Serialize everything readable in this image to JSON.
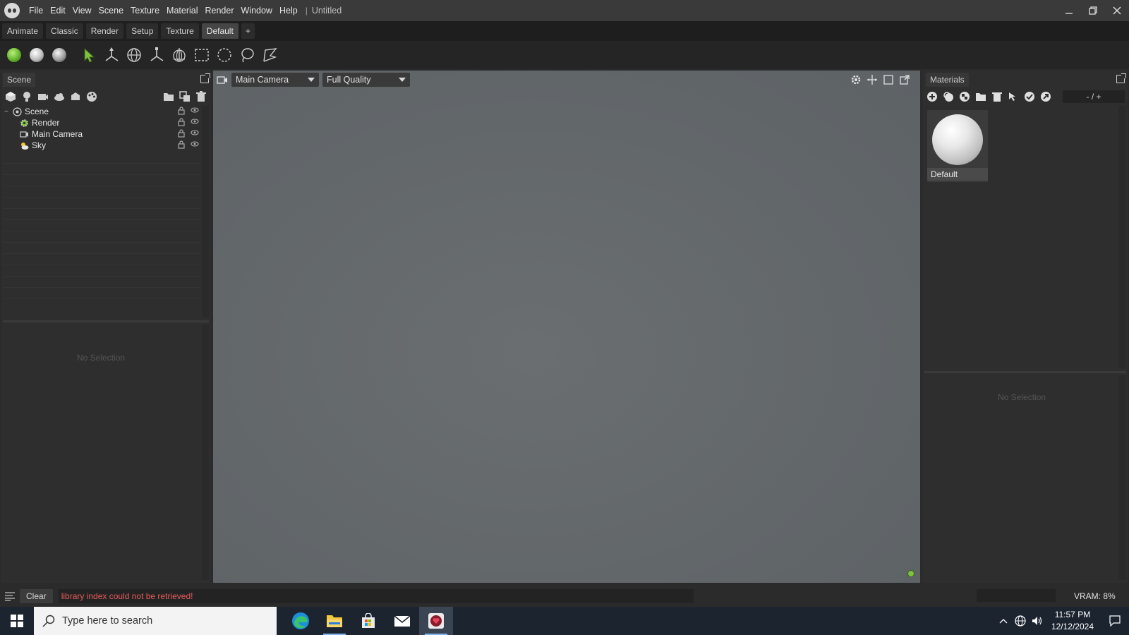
{
  "titlebar": {
    "menus": [
      "File",
      "Edit",
      "View",
      "Scene",
      "Texture",
      "Material",
      "Render",
      "Window",
      "Help"
    ],
    "separator": "|",
    "doc_title": "Untitled",
    "controls": {
      "minimize": "minimize-icon",
      "maximize": "restore-icon",
      "close": "close-icon"
    }
  },
  "layout_tabs": {
    "items": [
      "Animate",
      "Classic",
      "Render",
      "Setup",
      "Texture",
      "Default"
    ],
    "active": "Default",
    "add_label": "+"
  },
  "toolbar": {
    "shading": [
      "shading-solid-icon",
      "shading-smooth-icon",
      "shading-render-icon"
    ],
    "tools": [
      "select-arrow-icon",
      "move-icon",
      "rotate-icon",
      "scale-icon",
      "universal-icon",
      "rect-select-icon",
      "circle-select-icon",
      "lasso-select-icon",
      "poly-select-icon"
    ]
  },
  "scene_panel": {
    "tab": "Scene",
    "icons": [
      "add-object-icon",
      "add-light-icon",
      "add-camera-icon",
      "add-sky-icon",
      "add-group-icon",
      "palette-icon",
      "folder-icon",
      "duplicate-icon",
      "trash-icon"
    ],
    "tree": [
      {
        "label": "Scene",
        "icon": "scene-icon",
        "level": 0
      },
      {
        "label": "Render",
        "icon": "gear-icon",
        "level": 1
      },
      {
        "label": "Main Camera",
        "icon": "camera-icon",
        "level": 1
      },
      {
        "label": "Sky",
        "icon": "sky-icon",
        "level": 1
      }
    ],
    "no_selection": "No Selection"
  },
  "viewport": {
    "camera": "Main Camera",
    "quality": "Full Quality",
    "icons": [
      "gear-icon",
      "move-view-icon",
      "frame-icon",
      "popout-icon"
    ]
  },
  "materials_panel": {
    "tab": "Materials",
    "icons": [
      "add-material-icon",
      "duplicate-material-icon",
      "checker-icon",
      "folder-icon",
      "trash-icon",
      "pick-icon",
      "apply-icon",
      "export-icon"
    ],
    "zoom_label": "- / +",
    "items": [
      {
        "label": "Default"
      }
    ],
    "no_selection": "No Selection"
  },
  "statusbar": {
    "clear_label": "Clear",
    "message": "library index could not be retrieved!",
    "error_color": "#e85b5b",
    "vram": "VRAM: 8%"
  },
  "taskbar": {
    "search_placeholder": "Type here to search",
    "apps": [
      "edge-icon",
      "file-explorer-icon",
      "store-icon",
      "mail-icon",
      "app-heart-icon"
    ],
    "time": "11:57 PM",
    "date": "12/12/2024"
  },
  "colors": {
    "accent_green": "#7dc241",
    "error": "#e85b5b"
  }
}
